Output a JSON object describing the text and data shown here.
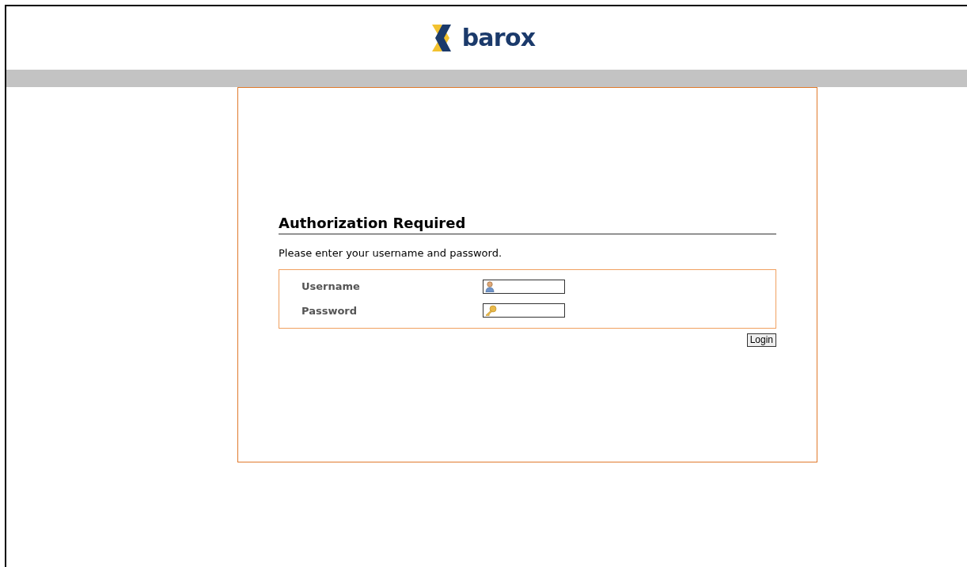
{
  "logo": {
    "text": "barox"
  },
  "heading": "Authorization Required",
  "intro": "Please enter your username and password.",
  "fields": [
    {
      "kind": "user",
      "label": "Username"
    },
    {
      "kind": "password",
      "label": "Password"
    }
  ],
  "button": "Login"
}
